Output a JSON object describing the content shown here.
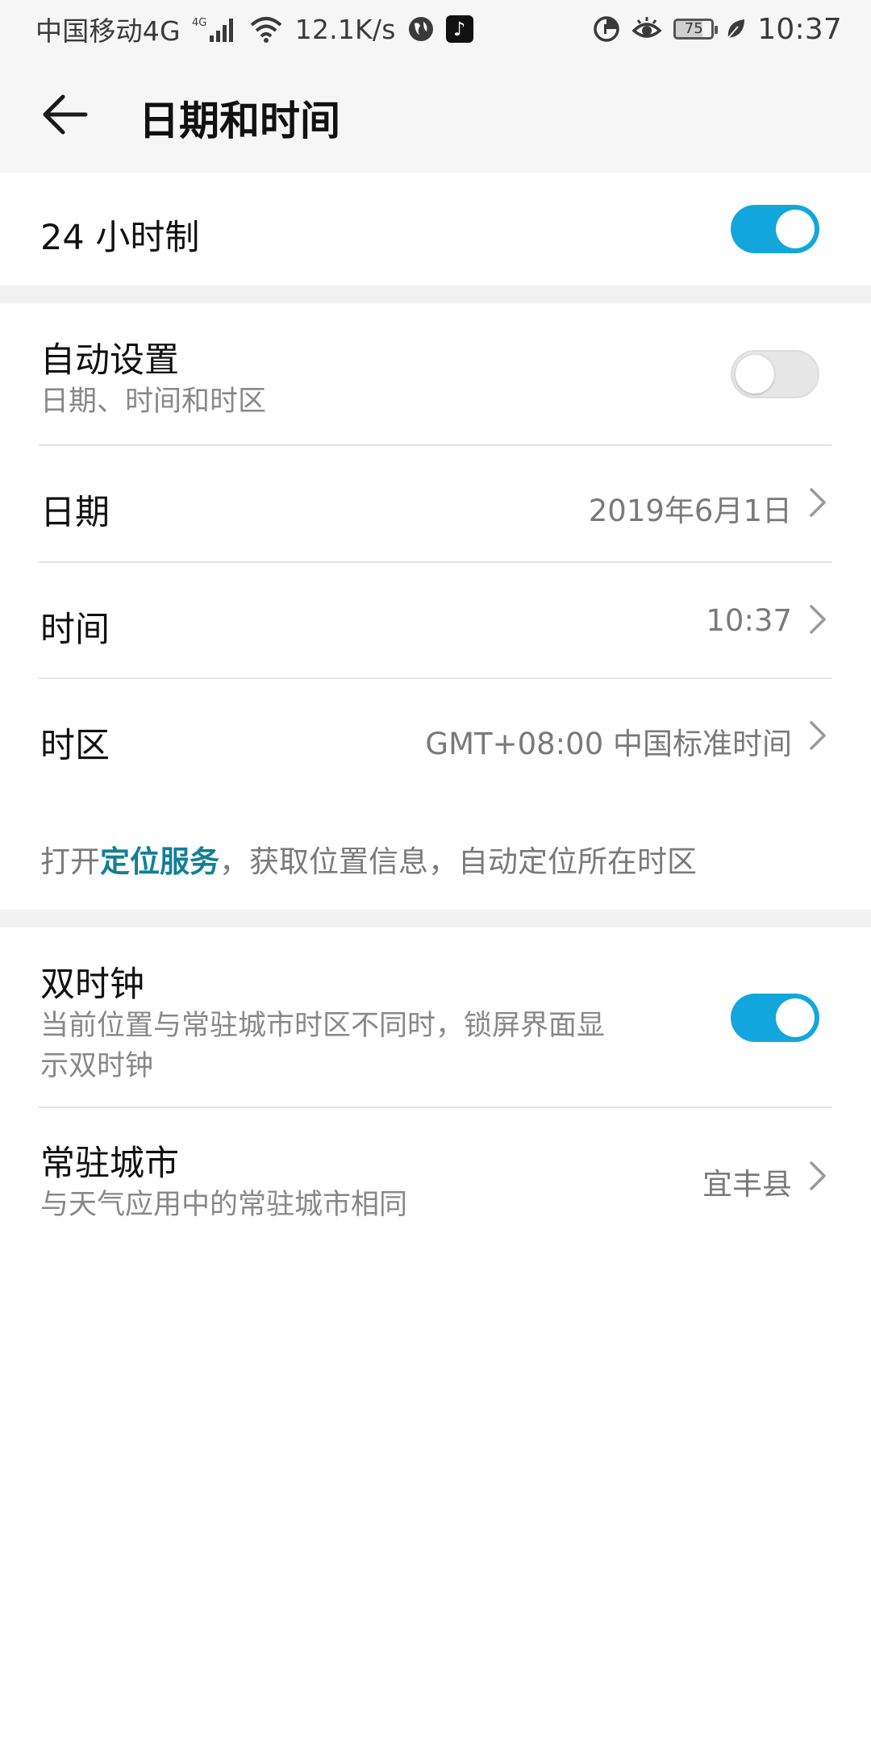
{
  "status_bar": {
    "carrier": "中国移动4G",
    "network_badge": "4G",
    "speed": "12.1K/s",
    "battery_level": "75",
    "time": "10:37",
    "icons": [
      "signal-icon",
      "wifi-icon",
      "globe-icon",
      "tiktok-icon",
      "data-saver-icon",
      "eye-icon",
      "battery-icon",
      "leaf-icon"
    ]
  },
  "header": {
    "title": "日期和时间"
  },
  "settings": {
    "hour24": {
      "label": "24 小时制",
      "on": true
    },
    "auto_set": {
      "label": "自动设置",
      "sub": "日期、时间和时区",
      "on": false
    },
    "date": {
      "label": "日期",
      "value": "2019年6月1日"
    },
    "time": {
      "label": "时间",
      "value": "10:37"
    },
    "timezone": {
      "label": "时区",
      "value": "GMT+08:00 中国标准时间"
    },
    "location_hint": {
      "prefix": "打开",
      "link": "定位服务",
      "suffix": "，获取位置信息，自动定位所在时区"
    },
    "dual_clock": {
      "label": "双时钟",
      "sub_line1": "当前位置与常驻城市时区不同时，锁屏界面显",
      "sub_line2": "示双时钟",
      "on": true
    },
    "home_city": {
      "label": "常驻城市",
      "sub": "与天气应用中的常驻城市相同",
      "value": "宜丰县"
    }
  },
  "colors": {
    "accent": "#12a6dc",
    "link": "#137f96",
    "background": "#ffffff",
    "header_bg": "#f6f6f6"
  }
}
